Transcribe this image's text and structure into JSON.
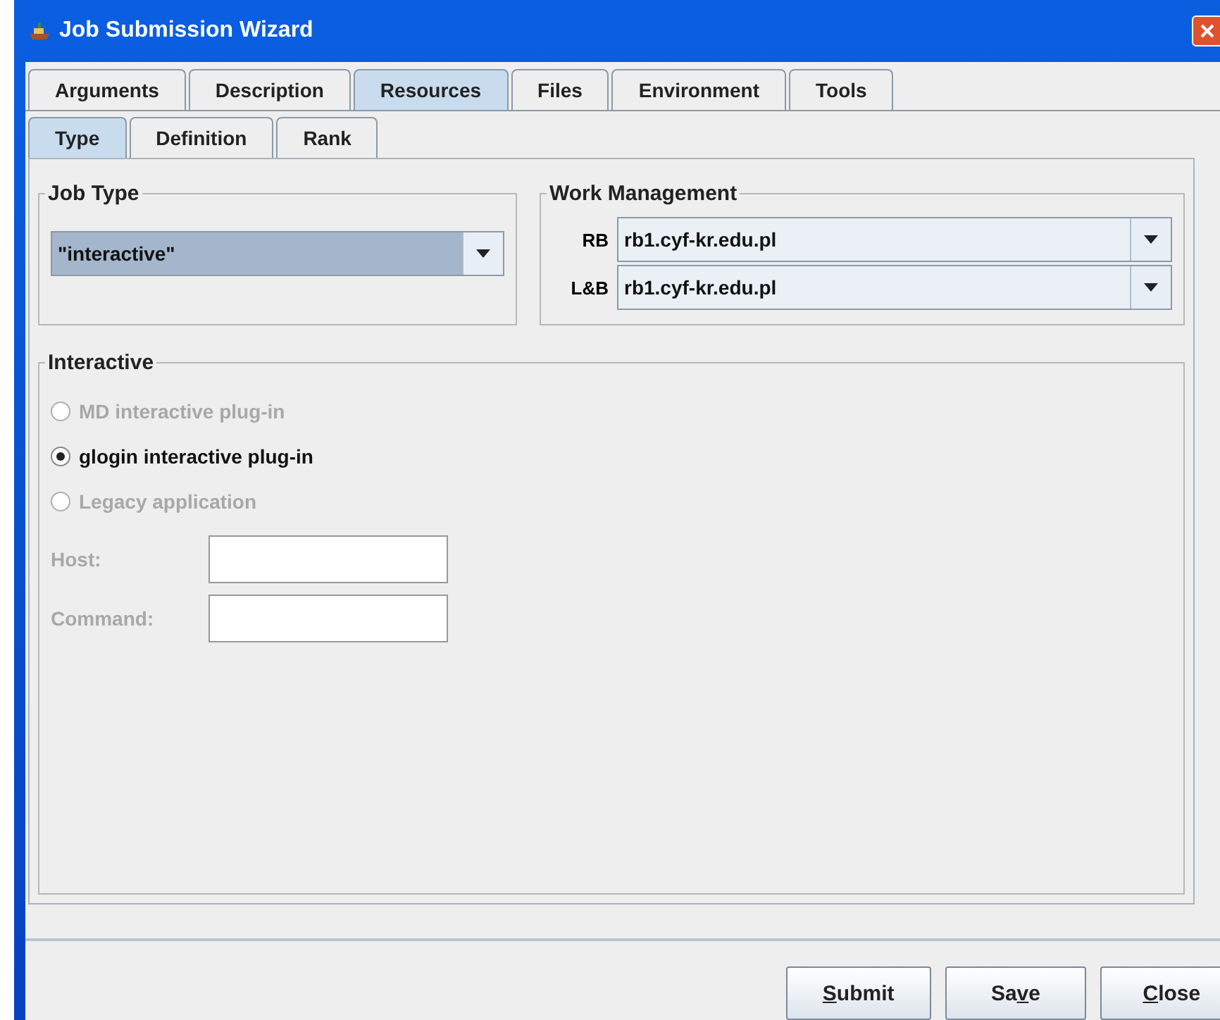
{
  "window": {
    "title": "Job Submission Wizard"
  },
  "tabs": [
    {
      "label": "Arguments",
      "selected": false
    },
    {
      "label": "Description",
      "selected": false
    },
    {
      "label": "Resources",
      "selected": true
    },
    {
      "label": "Files",
      "selected": false
    },
    {
      "label": "Environment",
      "selected": false
    },
    {
      "label": "Tools",
      "selected": false
    }
  ],
  "subtabs": [
    {
      "label": "Type",
      "selected": true
    },
    {
      "label": "Definition",
      "selected": false
    },
    {
      "label": "Rank",
      "selected": false
    }
  ],
  "job_type": {
    "title": "Job Type",
    "value": "\"interactive\""
  },
  "work_management": {
    "title": "Work Management",
    "rows": [
      {
        "label": "RB",
        "value": "rb1.cyf-kr.edu.pl"
      },
      {
        "label": "L&B",
        "value": "rb1.cyf-kr.edu.pl"
      }
    ]
  },
  "interactive": {
    "title": "Interactive",
    "options": [
      {
        "label": "MD interactive plug-in",
        "selected": false,
        "disabled": true
      },
      {
        "label": "glogin interactive plug-in",
        "selected": true,
        "disabled": false
      },
      {
        "label": "Legacy application",
        "selected": false,
        "disabled": true
      }
    ],
    "fields": [
      {
        "label": "Host:",
        "disabled": true
      },
      {
        "label": "Command:",
        "disabled": true
      }
    ]
  },
  "buttons": [
    {
      "label": "Submit"
    },
    {
      "label": "Save"
    },
    {
      "label": "Close"
    }
  ]
}
